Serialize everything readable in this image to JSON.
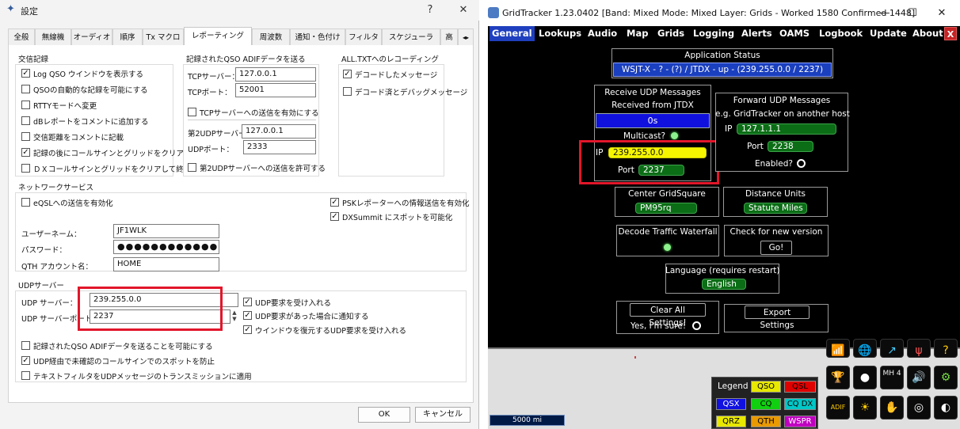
{
  "dialog": {
    "title": "設定",
    "help": "?",
    "close": "✕",
    "tabs": [
      "全般",
      "無線機",
      "オーディオ",
      "順序",
      "Tx マクロ",
      "レポーティング",
      "周波数",
      "通知・色付け",
      "フィルタ",
      "スケジューラ",
      "高"
    ],
    "selected_tab": "レポーティング",
    "logging": {
      "title": "交信記録",
      "items": [
        {
          "label": "Log QSO ウインドウを表示する",
          "checked": true
        },
        {
          "label": "QSOの自動的な記録を可能にする",
          "checked": false
        },
        {
          "label": "RTTYモードへ変更",
          "checked": false
        },
        {
          "label": "dBレポートをコメントに追加する",
          "checked": false
        },
        {
          "label": "交信距離をコメントに記載",
          "checked": false
        },
        {
          "label": "記録の後にコールサインとグリッドをクリアする",
          "checked": true
        },
        {
          "label": "ＤＸコールサインとグリッドをクリアして終了",
          "checked": false
        }
      ]
    },
    "adif": {
      "title": "記録されたQSO ADIFデータを送る",
      "tcp_server_label": "TCPサーバー：",
      "tcp_server_value": "127.0.0.1",
      "tcp_port_label": "TCPポート：",
      "tcp_port_value": "52001",
      "tcp_enable_label": "TCPサーバーへの送信を有効にする",
      "tcp_enable_checked": false,
      "udp2_server_label": "第2UDPサーバー",
      "udp2_server_value": "127.0.0.1",
      "udp2_port_label": "UDPポート：",
      "udp2_port_value": "2333",
      "udp2_enable_label": "第2UDPサーバーへの送信を許可する",
      "udp2_enable_checked": false
    },
    "alltxt": {
      "title": "ALL.TXTへのレコーディング",
      "items": [
        {
          "label": "デコードしたメッセージ",
          "checked": true
        },
        {
          "label": "デコード済とデバッグメッセージ",
          "checked": false
        }
      ]
    },
    "network": {
      "title": "ネットワークサービス",
      "eqsl_label": "eQSLへの送信を有効化",
      "eqsl_checked": false,
      "psk_label": "PSKレポーターへの情報送信を有効化",
      "psk_checked": true,
      "dx_label": "DXSummit にスポットを可能化",
      "dx_checked": true,
      "username_label": "ユーザーネーム：",
      "username_value": "JF1WLK",
      "password_label": "パスワード：",
      "password_value": "●●●●●●●●●●●●",
      "qth_label": "QTH アカウント名：",
      "qth_value": "HOME"
    },
    "udp": {
      "title": "UDPサーバー",
      "server_label": "UDP サーバー：",
      "server_value": "239.255.0.0",
      "port_label": "UDP サーバーポート：",
      "port_value": "2237",
      "accept_label": "UDP要求を受け入れる",
      "accept_checked": true,
      "notify_label": "UDP要求があった場合に通知する",
      "notify_checked": true,
      "restore_label": "ウインドウを復元するUDP要求を受け入れる",
      "restore_checked": true,
      "adif_enable_label": "記録されたQSO ADIFデータを送ることを可能にする",
      "adif_enable_checked": false,
      "prevent_label": "UDP経由で未確認のコールサインでのスポットを防止",
      "prevent_checked": true,
      "textfilter_label": "テキストフィルタをUDPメッセージのトランスミッションに適用",
      "textfilter_checked": false
    },
    "ok_label": "OK",
    "cancel_label": "キャンセル"
  },
  "gridtracker": {
    "title": "GridTracker 1.23.0402 [Band: Mixed Mode: Mixed Layer: Grids - Worked 1580 Confirmed 1448]",
    "win_min": "—",
    "win_max": "☐",
    "win_close": "✕",
    "menu": [
      "General",
      "Lookups",
      "Audio",
      "Map",
      "Grids",
      "Logging",
      "Alerts",
      "OAMS",
      "Logbook",
      "Update",
      "About"
    ],
    "menu_close": "X",
    "app_status_title": "Application Status",
    "app_status_value": "WSJT-X - ? - (?) / JTDX - up - (239.255.0.0 / 2237)",
    "receive_title": "Receive UDP Messages",
    "received_from": "Received from JTDX",
    "received_count": "0s",
    "multicast_label": "Multicast?",
    "ip_label": "IP",
    "ip_value": "239.255.0.0",
    "port_label": "Port",
    "port_value": "2237",
    "forward_title": "Forward UDP Messages",
    "forward_sub": "e.g. GridTracker on another host",
    "fwd_ip_label": "IP",
    "fwd_ip_value": "127.1.1.1",
    "fwd_port_label": "Port",
    "fwd_port_value": "2238",
    "enabled_label": "Enabled?",
    "center_grid_label": "Center GridSquare",
    "center_grid_value": "PM95rq",
    "distance_label": "Distance Units",
    "distance_value": "Statute Miles",
    "decode_label": "Decode Traffic Waterfall",
    "check_version_label": "Check for new version",
    "go_label": "Go!",
    "language_label": "Language (requires restart)",
    "language_value": "English",
    "clear_label": "Clear All Settings!",
    "sure_label": "Yes, I'm sure!",
    "export_label": "Export Settings",
    "scale_label": "5000 mi",
    "legend_title": "Legend",
    "legend": [
      {
        "label": "QSO",
        "bg": "#e8e800",
        "fg": "#000000"
      },
      {
        "label": "QSL",
        "bg": "#e00000",
        "fg": "#000000"
      },
      {
        "label": "QSX",
        "bg": "#1010e0",
        "fg": "#ffffff"
      },
      {
        "label": "CQ",
        "bg": "#10d010",
        "fg": "#000000"
      },
      {
        "label": "CQ DX",
        "bg": "#00c8c8",
        "fg": "#000000"
      },
      {
        "label": "QRZ",
        "bg": "#e8e800",
        "fg": "#000000"
      },
      {
        "label": "QTH",
        "bg": "#e89a00",
        "fg": "#000000"
      },
      {
        "label": "WSPR",
        "bg": "#c000c0",
        "fg": "#ffffff"
      }
    ],
    "tool_labels": [
      "MH 4",
      "ADIF"
    ]
  }
}
